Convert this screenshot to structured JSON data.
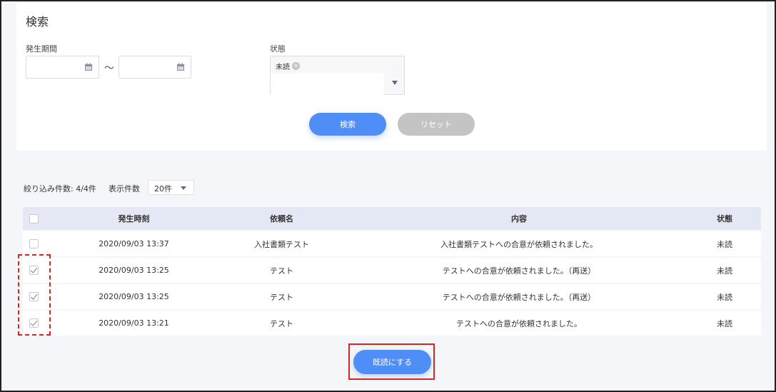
{
  "search": {
    "title": "検索",
    "period_label": "発生期間",
    "tilde": "～",
    "status_label": "状態",
    "status_tag": "未読",
    "search_button": "検索",
    "reset_button": "リセット"
  },
  "filter": {
    "count_text": "絞り込み件数: 4/4件",
    "page_size_label": "表示件数",
    "page_size_value": "20件"
  },
  "table": {
    "headers": {
      "time": "発生時刻",
      "name": "依頼名",
      "body": "内容",
      "state": "状態"
    },
    "rows": [
      {
        "checked": false,
        "time": "2020/09/03 13:37",
        "name": "入社書類テスト",
        "body": "入社書類テストへの合意が依頼されました。",
        "state": "未読"
      },
      {
        "checked": true,
        "time": "2020/09/03 13:25",
        "name": "テスト",
        "body": "テストへの合意が依頼されました。（再送）",
        "state": "未読"
      },
      {
        "checked": true,
        "time": "2020/09/03 13:25",
        "name": "テスト",
        "body": "テストへの合意が依頼されました。（再送）",
        "state": "未読"
      },
      {
        "checked": true,
        "time": "2020/09/03 13:21",
        "name": "テスト",
        "body": "テストへの合意が依頼されました。",
        "state": "未読"
      }
    ]
  },
  "actions": {
    "mark_read_button": "既読にする"
  },
  "colors": {
    "accent": "#4f8ef7",
    "highlight": "#d9261c",
    "header_bg": "#e4e8f4"
  }
}
